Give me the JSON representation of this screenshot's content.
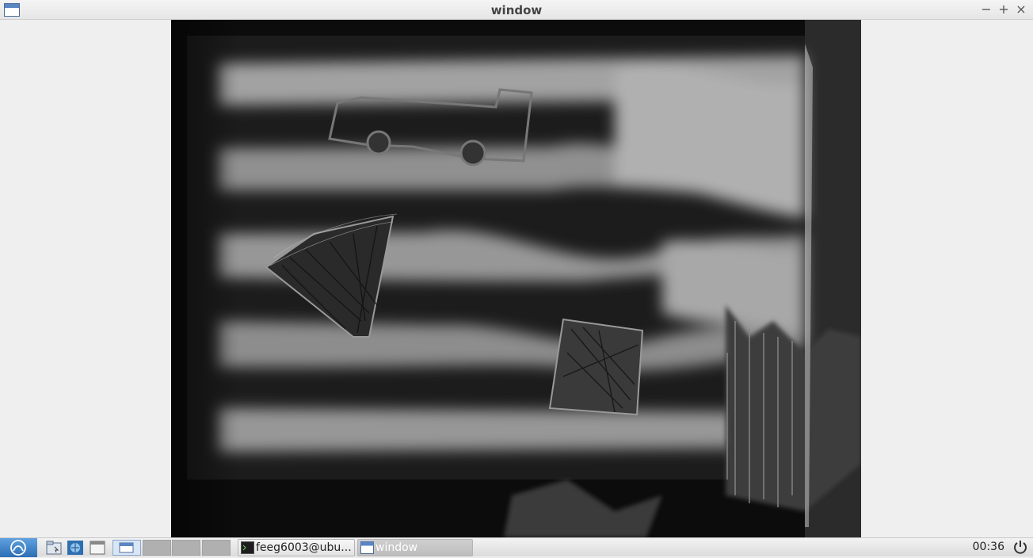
{
  "window": {
    "title": "window"
  },
  "window_controls": {
    "minimize": "−",
    "maximize": "+",
    "close": "×"
  },
  "taskbar": {
    "tasks": [
      {
        "label": "feeg6003@ubu...",
        "icon": "terminal-icon"
      },
      {
        "label": "window",
        "icon": "window-icon"
      }
    ],
    "clock": "00:36"
  },
  "colors": {
    "start_button": "#3b7fc8",
    "video_background": "#111111",
    "stripe_light": "#9a9a9a"
  }
}
